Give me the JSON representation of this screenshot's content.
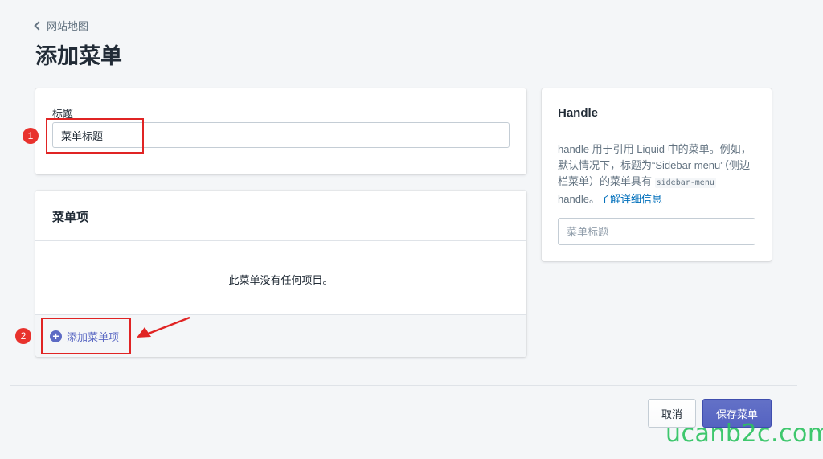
{
  "header": {
    "breadcrumb": "网站地图",
    "title": "添加菜单"
  },
  "title_card": {
    "label": "标题",
    "value": "菜单标题"
  },
  "items_card": {
    "title": "菜单项",
    "empty_message": "此菜单没有任何项目。",
    "add_label": "添加菜单项"
  },
  "handle_card": {
    "title": "Handle",
    "desc_part1": "handle 用于引用 Liquid 中的菜单。例如，默认情况下，标题为“Sidebar menu”（侧边栏菜单）的菜单具有 ",
    "desc_code": "sidebar-menu",
    "desc_part2": " handle。",
    "learn_more": "了解详细信息",
    "placeholder": "菜单标题"
  },
  "footer": {
    "cancel_label": "取消",
    "save_label": "保存菜单"
  },
  "annotations": {
    "marker_1": "1",
    "marker_2": "2"
  },
  "watermark": "ucanb2c.com",
  "colors": {
    "primary": "#5c6ac4",
    "link": "#006fbb",
    "annotation": "#e02424",
    "watermark": "#2bc25f"
  }
}
